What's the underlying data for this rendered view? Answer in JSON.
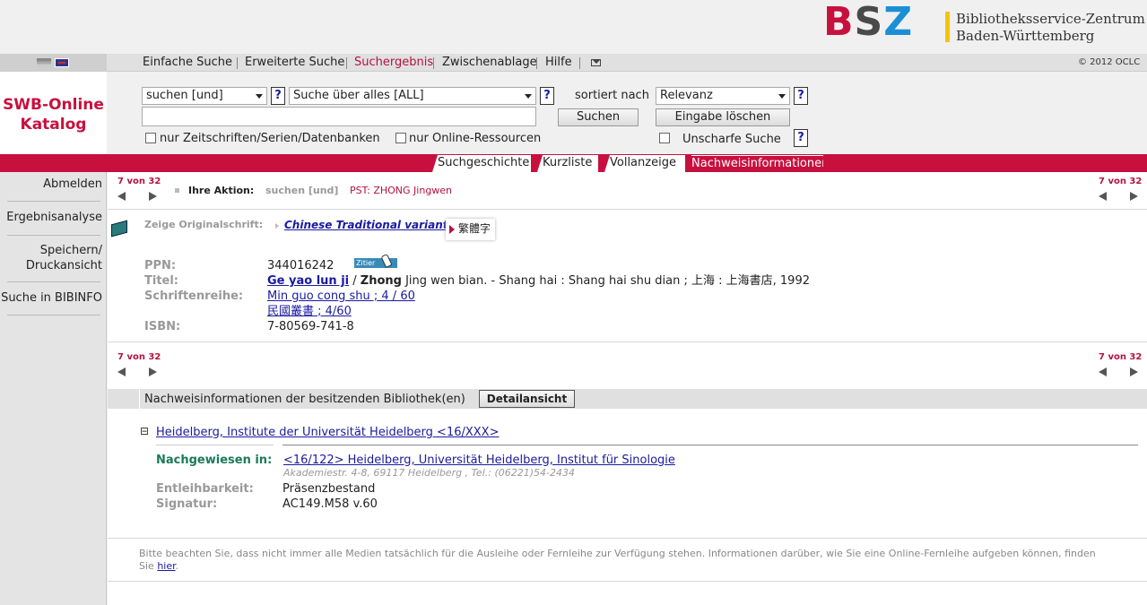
{
  "header": {
    "logo_text": "BSZ",
    "org_line1": "Bibliotheksservice-Zentrum",
    "org_line2": "Baden-Württemberg"
  },
  "topnav": {
    "items": [
      "Einfache Suche",
      "Erweiterte Suche",
      "Suchergebnis",
      "Zwischenablage",
      "Hilfe"
    ],
    "active": "Suchergebnis",
    "copyright": "© 2012 OCLC"
  },
  "brand": {
    "line1": "SWB-Online",
    "line2": "Katalog"
  },
  "search": {
    "mode_select": "suchen [und]",
    "field_select": "Suche über alles [ALL]",
    "sort_label": "sortiert nach",
    "sort_select": "Relevanz",
    "query_value": "",
    "search_button": "Suchen",
    "clear_button": "Eingabe löschen",
    "chk_journals": "nur Zeitschriften/Serien/Datenbanken",
    "chk_online": "nur Online-Ressourcen",
    "chk_fuzzy": "Unscharfe Suche",
    "help_glyph": "?"
  },
  "tabs": [
    "Suchgeschichte",
    "Kurzliste",
    "Vollanzeige",
    "Nachweisinformationen"
  ],
  "sidebar": {
    "items": [
      "Abmelden",
      "Ergebnisanalyse",
      "Speichern/",
      "Druckansicht",
      "Suche in BIBINFO"
    ]
  },
  "pager": {
    "count": "7 von 32"
  },
  "action": {
    "label": "Ihre Aktion:",
    "mode": "suchen [und]",
    "query": "PST: ZHONG Jingwen"
  },
  "record": {
    "orig_label": "Zeige Originalschrift:",
    "orig_link": "Chinese Traditional variant",
    "orig_script": "繁體字",
    "ppn_label": "PPN:",
    "ppn": "344016242",
    "cite_label": "Zitier",
    "titel_label": "Titel:",
    "title_link": "Ge yao lun ji",
    "title_sep": " / ",
    "author_bold": "Zhong",
    "title_rest": " Jing wen bian. - Shang hai : Shang hai shu dian ; 上海 : 上海書店, 1992",
    "series_label": "Schriftenreihe:",
    "series_link1": "Min guo cong shu ; 4 / 60",
    "series_link2": "民國叢書 ; 4/60",
    "isbn_label": "ISBN:",
    "isbn": "7-80569-741-8"
  },
  "holdings": {
    "bar_label": "Nachweisinformationen der besitzenden Bibliothek(en)",
    "detail_button": "Detailansicht",
    "toggle_glyph": "⊟",
    "library_link": "Heidelberg, Institute der Universität Heidelberg <16/XXX>",
    "nachgewiesen_label": "Nachgewiesen in:",
    "nachgewiesen_link": "<16/122> Heidelberg, Universität Heidelberg, Institut für Sinologie",
    "address": "Akademiestr. 4-8, 69117 Heidelberg , Tel.: (06221)54-2434",
    "entleih_label": "Entleihbarkeit:",
    "entleih_value": "Präsenzbestand",
    "signatur_label": "Signatur:",
    "signatur_value": "AC149.M58 v.60"
  },
  "footer": {
    "note_line1": "Bitte beachten Sie, dass nicht immer alle Medien tatsächlich für die Ausleihe oder Fernleihe zur Verfügung stehen. Informationen darüber, wie Sie eine Online-Fernleihe aufgeben können, finden",
    "note_sie": "Sie",
    "note_link": "hier",
    "note_end": "."
  },
  "colors": {
    "brand_red": "#c8103e",
    "link_blue": "#1a1aa0",
    "nachgewiesen_green": "#1a7a5a"
  }
}
